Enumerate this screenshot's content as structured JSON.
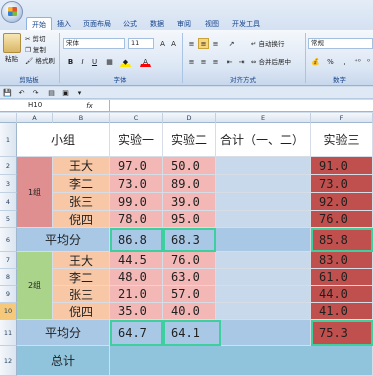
{
  "ribbon": {
    "tabs": [
      "开始",
      "插入",
      "页面布局",
      "公式",
      "数据",
      "审阅",
      "视图",
      "开发工具"
    ],
    "clipboard": {
      "paste": "粘贴",
      "cut": "剪切",
      "copy": "复制",
      "format_painter": "格式刷",
      "group": "剪贴板"
    },
    "font": {
      "name": "宋体",
      "size": "11",
      "group": "字体"
    },
    "alignment": {
      "wrap": "自动换行",
      "merge": "合并后居中",
      "group": "对齐方式"
    },
    "number": {
      "format": "常规",
      "percent": "%",
      "group": "数字"
    }
  },
  "formula_bar": {
    "name_box": "H10",
    "fx": "fx",
    "formula": ""
  },
  "columns": [
    "A",
    "B",
    "C",
    "D",
    "E",
    "F"
  ],
  "rows": [
    "1",
    "2",
    "3",
    "4",
    "5",
    "6",
    "7",
    "8",
    "9",
    "10",
    "11",
    "12"
  ],
  "sheet": {
    "header": {
      "group": "小组",
      "exp1": "实验一",
      "exp2": "实验二",
      "total": "合计（一、二）",
      "exp3": "实验三"
    },
    "group1": {
      "label": "1组",
      "rows": [
        {
          "name": "王大",
          "exp1": "97.0",
          "exp2": "50.0",
          "exp3": "91.0"
        },
        {
          "name": "李二",
          "exp1": "73.0",
          "exp2": "89.0",
          "exp3": "73.0"
        },
        {
          "name": "张三",
          "exp1": "99.0",
          "exp2": "39.0",
          "exp3": "92.0"
        },
        {
          "name": "倪四",
          "exp1": "78.0",
          "exp2": "95.0",
          "exp3": "76.0"
        }
      ],
      "avg_label": "平均分",
      "avg1": "86.8",
      "avg2": "68.3",
      "avg3": "85.8"
    },
    "group2": {
      "label": "2组",
      "rows": [
        {
          "name": "王大",
          "exp1": "44.5",
          "exp2": "76.0",
          "exp3": "83.0"
        },
        {
          "name": "李二",
          "exp1": "48.0",
          "exp2": "63.0",
          "exp3": "61.0"
        },
        {
          "name": "张三",
          "exp1": "21.0",
          "exp2": "57.0",
          "exp3": "44.0"
        },
        {
          "name": "倪四",
          "exp1": "35.0",
          "exp2": "40.0",
          "exp3": "41.0"
        }
      ],
      "avg_label": "平均分",
      "avg1": "64.7",
      "avg2": "64.1",
      "avg3": "75.3"
    },
    "total_label": "总计"
  },
  "colors": {
    "g1_label": "#df8f8f",
    "g2_label": "#a9d48a",
    "name": "#f7c7a6",
    "score": "#f3b8b6",
    "avg": "#a9c8e6",
    "total_col": "#c9d9ec",
    "exp3": "#c0504d",
    "highlight": "#3ecf9f"
  }
}
